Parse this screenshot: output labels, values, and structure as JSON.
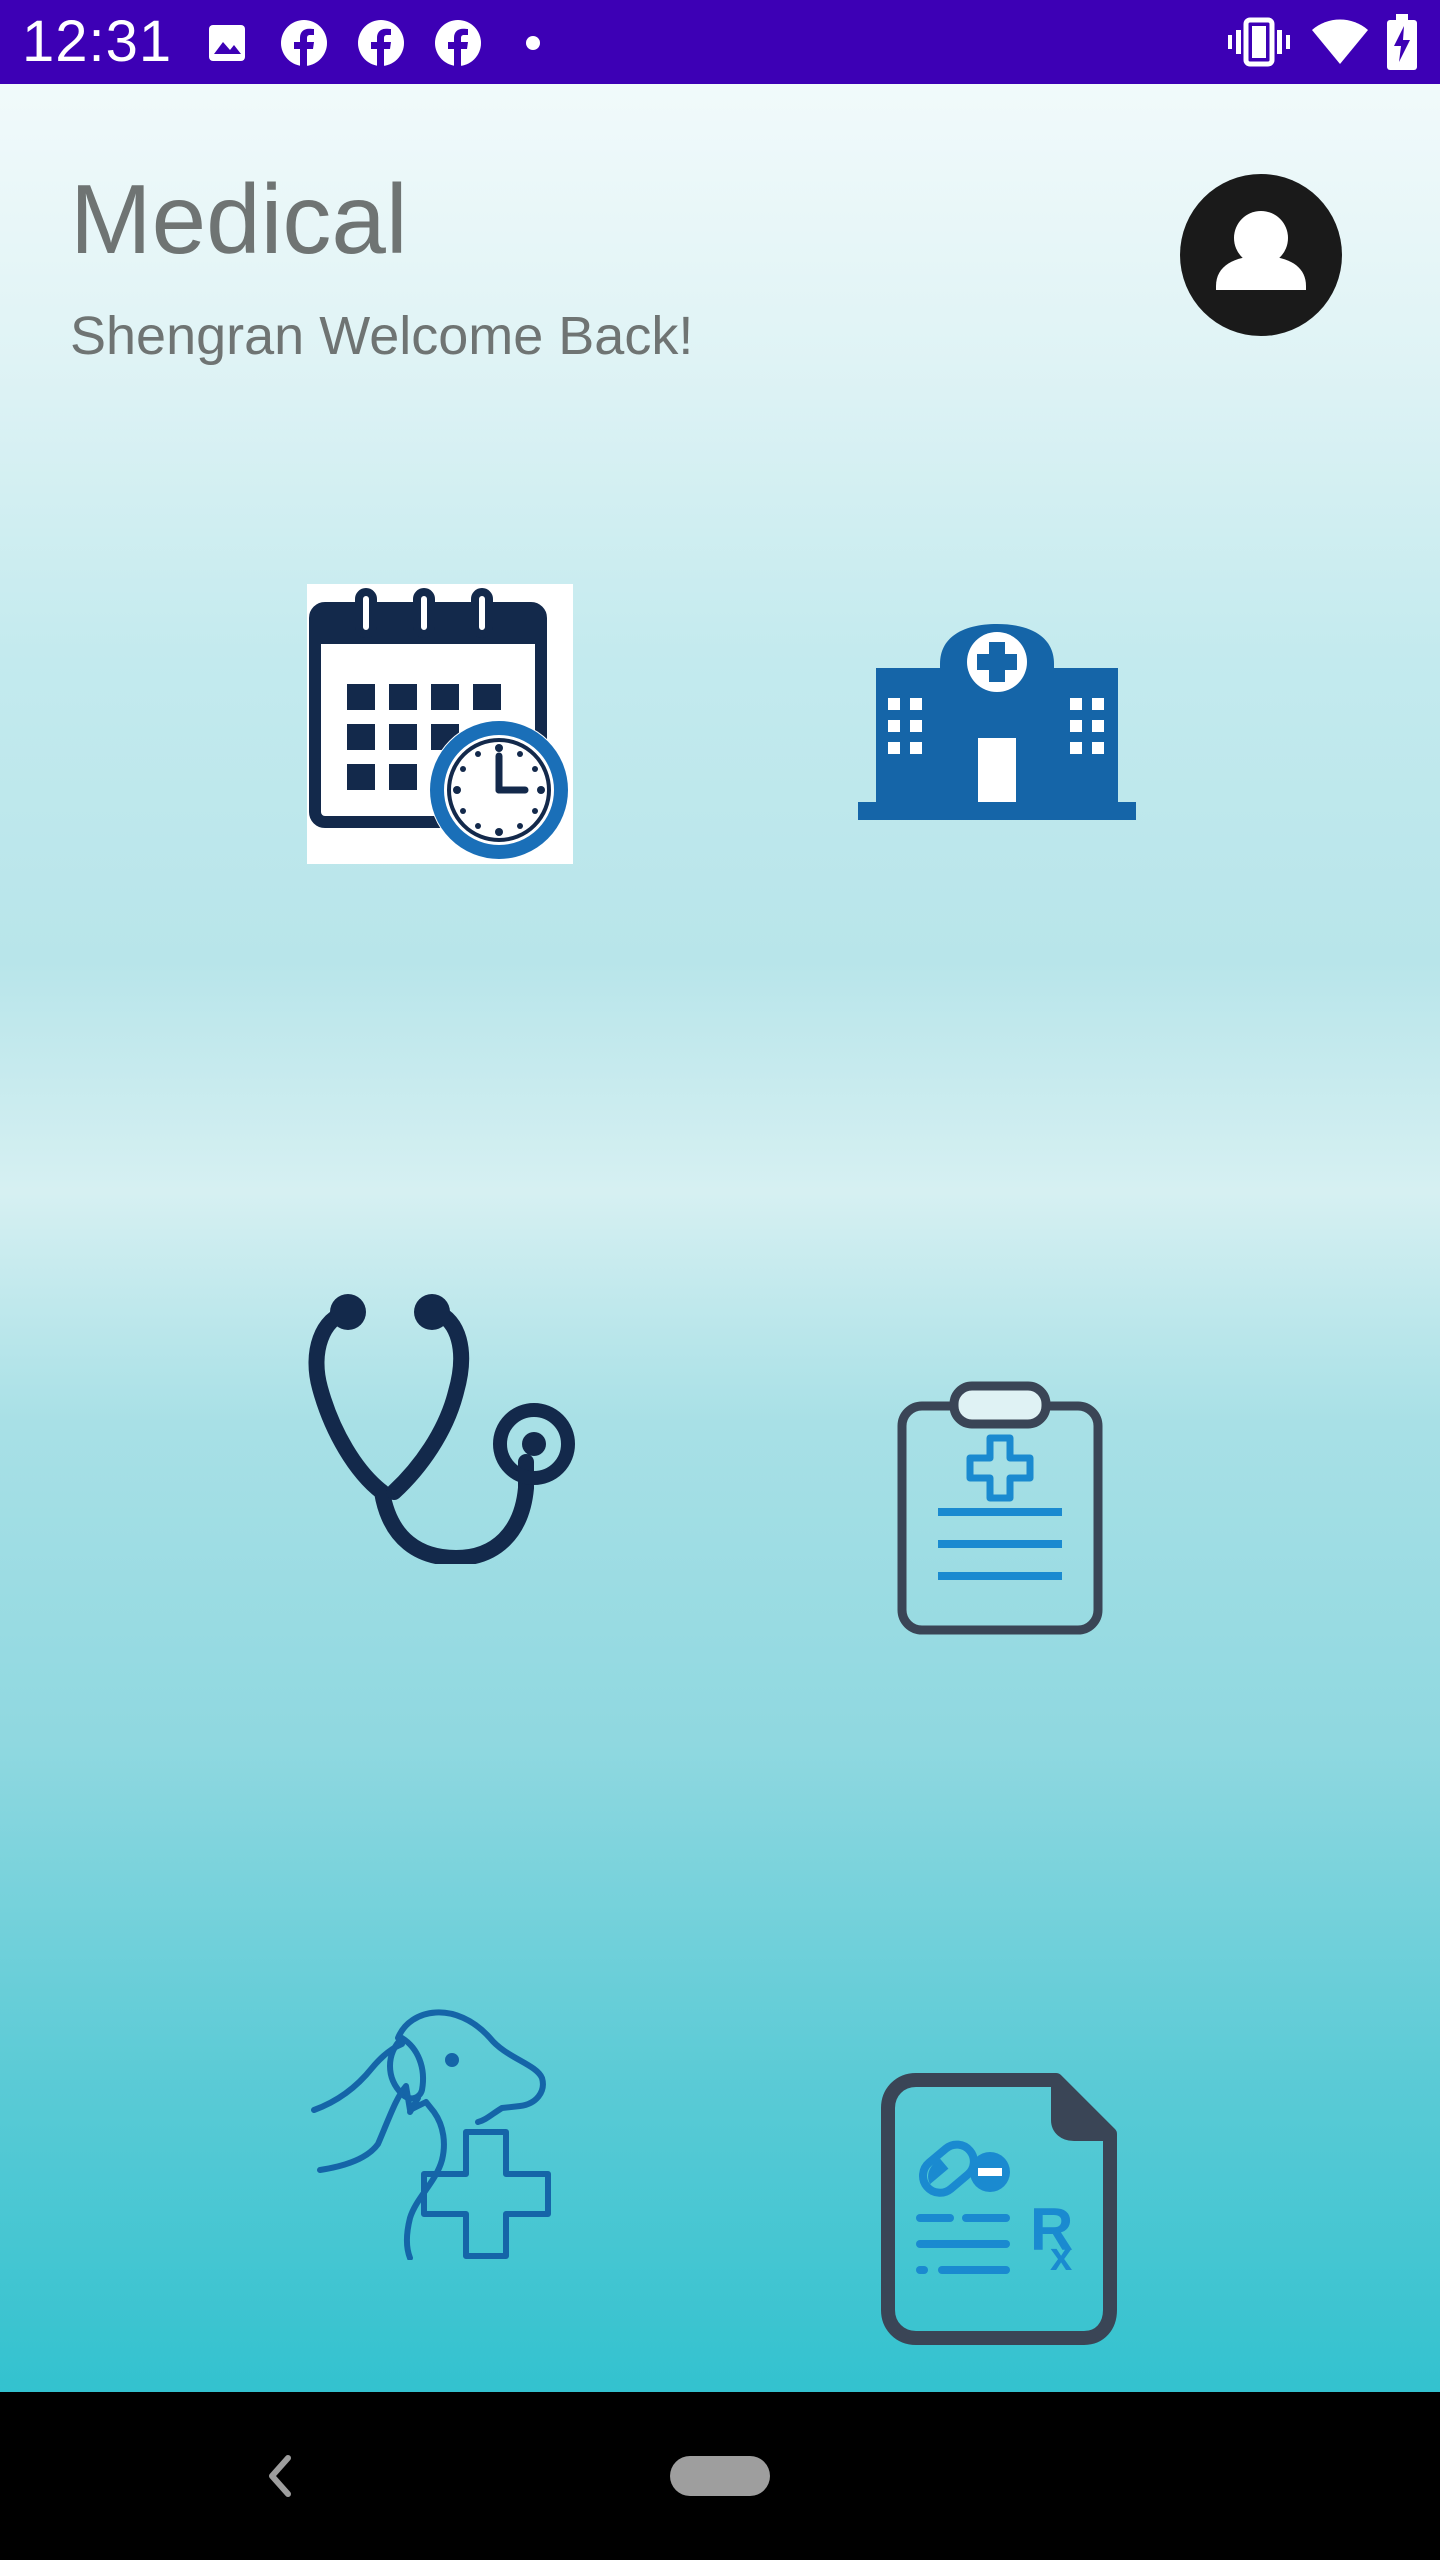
{
  "status_bar": {
    "time": "12:31",
    "background": "#3d00b5",
    "left_icons": [
      "image-icon",
      "facebook-icon",
      "facebook-icon",
      "facebook-icon",
      "dot-icon"
    ],
    "right_icons": [
      "vibrate-icon",
      "wifi-icon",
      "battery-charging-icon"
    ]
  },
  "header": {
    "title": "Medical",
    "subtitle": "Shengran Welcome Back!",
    "profile_icon": "user-avatar-icon"
  },
  "tiles": [
    {
      "icon": "calendar-clock-icon"
    },
    {
      "icon": "hospital-icon"
    },
    {
      "icon": "stethoscope-icon"
    },
    {
      "icon": "medical-clipboard-icon"
    },
    {
      "icon": "pet-care-icon"
    },
    {
      "icon": "prescription-icon"
    }
  ],
  "colors": {
    "title_text": "#6f7473",
    "navy": "#13294b",
    "blue": "#1565a8",
    "accent_blue": "#1a8ad0",
    "slate": "#3a4556"
  },
  "nav_bar": {
    "back_icon": "back-chevron-icon",
    "home_icon": "home-pill-icon"
  }
}
